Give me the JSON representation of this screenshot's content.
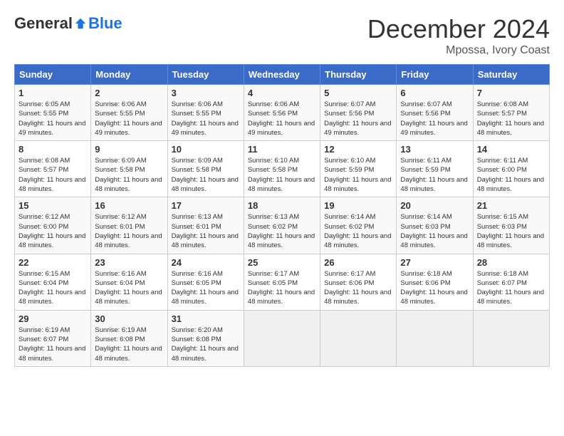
{
  "header": {
    "logo": {
      "general": "General",
      "blue": "Blue"
    },
    "title": "December 2024",
    "location": "Mpossa, Ivory Coast"
  },
  "calendar": {
    "days_of_week": [
      "Sunday",
      "Monday",
      "Tuesday",
      "Wednesday",
      "Thursday",
      "Friday",
      "Saturday"
    ],
    "weeks": [
      [
        {
          "day": "",
          "empty": true
        },
        {
          "day": "",
          "empty": true
        },
        {
          "day": "",
          "empty": true
        },
        {
          "day": "",
          "empty": true
        },
        {
          "day": "",
          "empty": true
        },
        {
          "day": "",
          "empty": true
        },
        {
          "day": "",
          "empty": true
        }
      ],
      [
        {
          "day": "1",
          "sunrise": "6:05 AM",
          "sunset": "5:55 PM",
          "daylight": "11 hours and 49 minutes."
        },
        {
          "day": "2",
          "sunrise": "6:06 AM",
          "sunset": "5:55 PM",
          "daylight": "11 hours and 49 minutes."
        },
        {
          "day": "3",
          "sunrise": "6:06 AM",
          "sunset": "5:55 PM",
          "daylight": "11 hours and 49 minutes."
        },
        {
          "day": "4",
          "sunrise": "6:06 AM",
          "sunset": "5:56 PM",
          "daylight": "11 hours and 49 minutes."
        },
        {
          "day": "5",
          "sunrise": "6:07 AM",
          "sunset": "5:56 PM",
          "daylight": "11 hours and 49 minutes."
        },
        {
          "day": "6",
          "sunrise": "6:07 AM",
          "sunset": "5:56 PM",
          "daylight": "11 hours and 49 minutes."
        },
        {
          "day": "7",
          "sunrise": "6:08 AM",
          "sunset": "5:57 PM",
          "daylight": "11 hours and 48 minutes."
        }
      ],
      [
        {
          "day": "8",
          "sunrise": "6:08 AM",
          "sunset": "5:57 PM",
          "daylight": "11 hours and 48 minutes."
        },
        {
          "day": "9",
          "sunrise": "6:09 AM",
          "sunset": "5:58 PM",
          "daylight": "11 hours and 48 minutes."
        },
        {
          "day": "10",
          "sunrise": "6:09 AM",
          "sunset": "5:58 PM",
          "daylight": "11 hours and 48 minutes."
        },
        {
          "day": "11",
          "sunrise": "6:10 AM",
          "sunset": "5:58 PM",
          "daylight": "11 hours and 48 minutes."
        },
        {
          "day": "12",
          "sunrise": "6:10 AM",
          "sunset": "5:59 PM",
          "daylight": "11 hours and 48 minutes."
        },
        {
          "day": "13",
          "sunrise": "6:11 AM",
          "sunset": "5:59 PM",
          "daylight": "11 hours and 48 minutes."
        },
        {
          "day": "14",
          "sunrise": "6:11 AM",
          "sunset": "6:00 PM",
          "daylight": "11 hours and 48 minutes."
        }
      ],
      [
        {
          "day": "15",
          "sunrise": "6:12 AM",
          "sunset": "6:00 PM",
          "daylight": "11 hours and 48 minutes."
        },
        {
          "day": "16",
          "sunrise": "6:12 AM",
          "sunset": "6:01 PM",
          "daylight": "11 hours and 48 minutes."
        },
        {
          "day": "17",
          "sunrise": "6:13 AM",
          "sunset": "6:01 PM",
          "daylight": "11 hours and 48 minutes."
        },
        {
          "day": "18",
          "sunrise": "6:13 AM",
          "sunset": "6:02 PM",
          "daylight": "11 hours and 48 minutes."
        },
        {
          "day": "19",
          "sunrise": "6:14 AM",
          "sunset": "6:02 PM",
          "daylight": "11 hours and 48 minutes."
        },
        {
          "day": "20",
          "sunrise": "6:14 AM",
          "sunset": "6:03 PM",
          "daylight": "11 hours and 48 minutes."
        },
        {
          "day": "21",
          "sunrise": "6:15 AM",
          "sunset": "6:03 PM",
          "daylight": "11 hours and 48 minutes."
        }
      ],
      [
        {
          "day": "22",
          "sunrise": "6:15 AM",
          "sunset": "6:04 PM",
          "daylight": "11 hours and 48 minutes."
        },
        {
          "day": "23",
          "sunrise": "6:16 AM",
          "sunset": "6:04 PM",
          "daylight": "11 hours and 48 minutes."
        },
        {
          "day": "24",
          "sunrise": "6:16 AM",
          "sunset": "6:05 PM",
          "daylight": "11 hours and 48 minutes."
        },
        {
          "day": "25",
          "sunrise": "6:17 AM",
          "sunset": "6:05 PM",
          "daylight": "11 hours and 48 minutes."
        },
        {
          "day": "26",
          "sunrise": "6:17 AM",
          "sunset": "6:06 PM",
          "daylight": "11 hours and 48 minutes."
        },
        {
          "day": "27",
          "sunrise": "6:18 AM",
          "sunset": "6:06 PM",
          "daylight": "11 hours and 48 minutes."
        },
        {
          "day": "28",
          "sunrise": "6:18 AM",
          "sunset": "6:07 PM",
          "daylight": "11 hours and 48 minutes."
        }
      ],
      [
        {
          "day": "29",
          "sunrise": "6:19 AM",
          "sunset": "6:07 PM",
          "daylight": "11 hours and 48 minutes."
        },
        {
          "day": "30",
          "sunrise": "6:19 AM",
          "sunset": "6:08 PM",
          "daylight": "11 hours and 48 minutes."
        },
        {
          "day": "31",
          "sunrise": "6:20 AM",
          "sunset": "6:08 PM",
          "daylight": "11 hours and 48 minutes."
        },
        {
          "day": "",
          "empty": true
        },
        {
          "day": "",
          "empty": true
        },
        {
          "day": "",
          "empty": true
        },
        {
          "day": "",
          "empty": true
        }
      ]
    ]
  }
}
